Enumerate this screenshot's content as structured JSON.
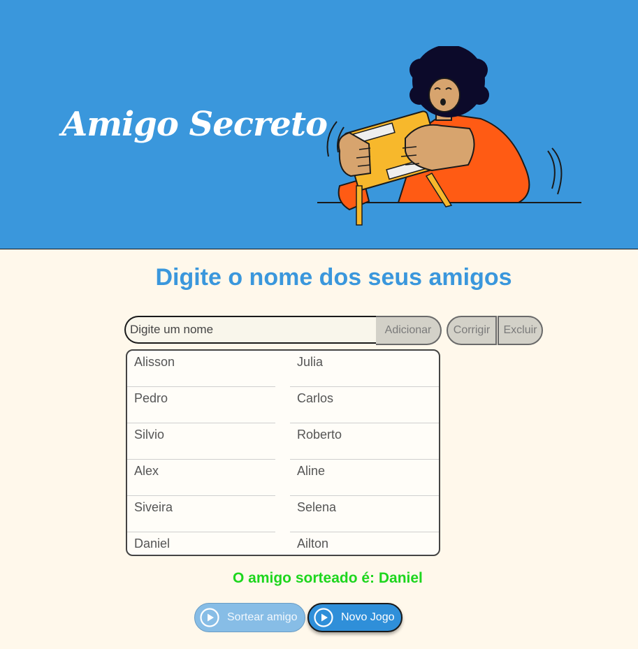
{
  "header": {
    "title": "Amigo Secreto"
  },
  "main": {
    "subtitle": "Digite o nome dos seus amigos",
    "input": {
      "placeholder": "Digite um nome",
      "value": ""
    },
    "add_label": "Adicionar",
    "fix_label": "Corrigir",
    "delete_label": "Excluir",
    "friends": [
      "Alisson",
      "Julia",
      "Pedro",
      "Carlos",
      "Silvio",
      "Roberto",
      "Alex",
      "Aline",
      "Siveira",
      "Selena",
      "Daniel",
      "Ailton"
    ],
    "result": "O amigo sorteado é: Daniel",
    "draw_label": "Sortear amigo",
    "new_game_label": "Novo Jogo"
  },
  "colors": {
    "header_bg": "#3a97dc",
    "page_bg": "#fff8eb",
    "accent": "#3a97dc",
    "result": "#1dd61d",
    "disabled_bg": "#d3d1c8"
  },
  "icons": {
    "illustration": "person-holding-gift-box",
    "play": "play-circle-icon"
  }
}
